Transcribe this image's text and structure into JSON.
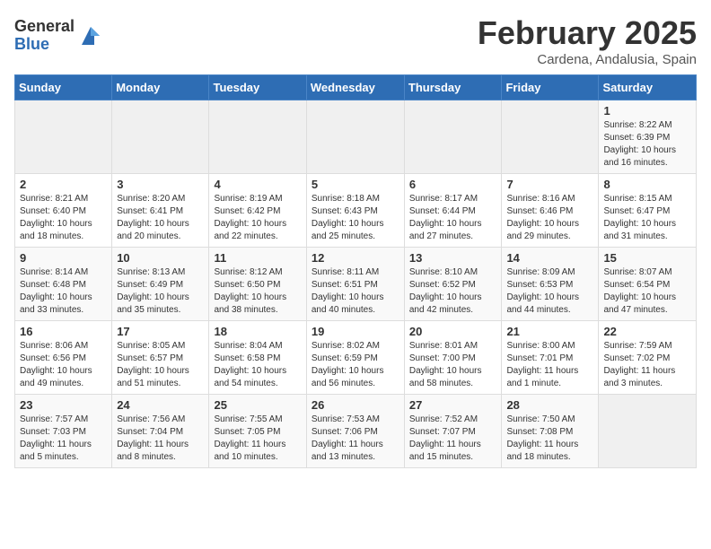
{
  "header": {
    "logo_general": "General",
    "logo_blue": "Blue",
    "month_title": "February 2025",
    "location": "Cardena, Andalusia, Spain"
  },
  "weekdays": [
    "Sunday",
    "Monday",
    "Tuesday",
    "Wednesday",
    "Thursday",
    "Friday",
    "Saturday"
  ],
  "weeks": [
    [
      {
        "day": "",
        "info": ""
      },
      {
        "day": "",
        "info": ""
      },
      {
        "day": "",
        "info": ""
      },
      {
        "day": "",
        "info": ""
      },
      {
        "day": "",
        "info": ""
      },
      {
        "day": "",
        "info": ""
      },
      {
        "day": "1",
        "info": "Sunrise: 8:22 AM\nSunset: 6:39 PM\nDaylight: 10 hours\nand 16 minutes."
      }
    ],
    [
      {
        "day": "2",
        "info": "Sunrise: 8:21 AM\nSunset: 6:40 PM\nDaylight: 10 hours\nand 18 minutes."
      },
      {
        "day": "3",
        "info": "Sunrise: 8:20 AM\nSunset: 6:41 PM\nDaylight: 10 hours\nand 20 minutes."
      },
      {
        "day": "4",
        "info": "Sunrise: 8:19 AM\nSunset: 6:42 PM\nDaylight: 10 hours\nand 22 minutes."
      },
      {
        "day": "5",
        "info": "Sunrise: 8:18 AM\nSunset: 6:43 PM\nDaylight: 10 hours\nand 25 minutes."
      },
      {
        "day": "6",
        "info": "Sunrise: 8:17 AM\nSunset: 6:44 PM\nDaylight: 10 hours\nand 27 minutes."
      },
      {
        "day": "7",
        "info": "Sunrise: 8:16 AM\nSunset: 6:46 PM\nDaylight: 10 hours\nand 29 minutes."
      },
      {
        "day": "8",
        "info": "Sunrise: 8:15 AM\nSunset: 6:47 PM\nDaylight: 10 hours\nand 31 minutes."
      }
    ],
    [
      {
        "day": "9",
        "info": "Sunrise: 8:14 AM\nSunset: 6:48 PM\nDaylight: 10 hours\nand 33 minutes."
      },
      {
        "day": "10",
        "info": "Sunrise: 8:13 AM\nSunset: 6:49 PM\nDaylight: 10 hours\nand 35 minutes."
      },
      {
        "day": "11",
        "info": "Sunrise: 8:12 AM\nSunset: 6:50 PM\nDaylight: 10 hours\nand 38 minutes."
      },
      {
        "day": "12",
        "info": "Sunrise: 8:11 AM\nSunset: 6:51 PM\nDaylight: 10 hours\nand 40 minutes."
      },
      {
        "day": "13",
        "info": "Sunrise: 8:10 AM\nSunset: 6:52 PM\nDaylight: 10 hours\nand 42 minutes."
      },
      {
        "day": "14",
        "info": "Sunrise: 8:09 AM\nSunset: 6:53 PM\nDaylight: 10 hours\nand 44 minutes."
      },
      {
        "day": "15",
        "info": "Sunrise: 8:07 AM\nSunset: 6:54 PM\nDaylight: 10 hours\nand 47 minutes."
      }
    ],
    [
      {
        "day": "16",
        "info": "Sunrise: 8:06 AM\nSunset: 6:56 PM\nDaylight: 10 hours\nand 49 minutes."
      },
      {
        "day": "17",
        "info": "Sunrise: 8:05 AM\nSunset: 6:57 PM\nDaylight: 10 hours\nand 51 minutes."
      },
      {
        "day": "18",
        "info": "Sunrise: 8:04 AM\nSunset: 6:58 PM\nDaylight: 10 hours\nand 54 minutes."
      },
      {
        "day": "19",
        "info": "Sunrise: 8:02 AM\nSunset: 6:59 PM\nDaylight: 10 hours\nand 56 minutes."
      },
      {
        "day": "20",
        "info": "Sunrise: 8:01 AM\nSunset: 7:00 PM\nDaylight: 10 hours\nand 58 minutes."
      },
      {
        "day": "21",
        "info": "Sunrise: 8:00 AM\nSunset: 7:01 PM\nDaylight: 11 hours\nand 1 minute."
      },
      {
        "day": "22",
        "info": "Sunrise: 7:59 AM\nSunset: 7:02 PM\nDaylight: 11 hours\nand 3 minutes."
      }
    ],
    [
      {
        "day": "23",
        "info": "Sunrise: 7:57 AM\nSunset: 7:03 PM\nDaylight: 11 hours\nand 5 minutes."
      },
      {
        "day": "24",
        "info": "Sunrise: 7:56 AM\nSunset: 7:04 PM\nDaylight: 11 hours\nand 8 minutes."
      },
      {
        "day": "25",
        "info": "Sunrise: 7:55 AM\nSunset: 7:05 PM\nDaylight: 11 hours\nand 10 minutes."
      },
      {
        "day": "26",
        "info": "Sunrise: 7:53 AM\nSunset: 7:06 PM\nDaylight: 11 hours\nand 13 minutes."
      },
      {
        "day": "27",
        "info": "Sunrise: 7:52 AM\nSunset: 7:07 PM\nDaylight: 11 hours\nand 15 minutes."
      },
      {
        "day": "28",
        "info": "Sunrise: 7:50 AM\nSunset: 7:08 PM\nDaylight: 11 hours\nand 18 minutes."
      },
      {
        "day": "",
        "info": ""
      }
    ]
  ]
}
